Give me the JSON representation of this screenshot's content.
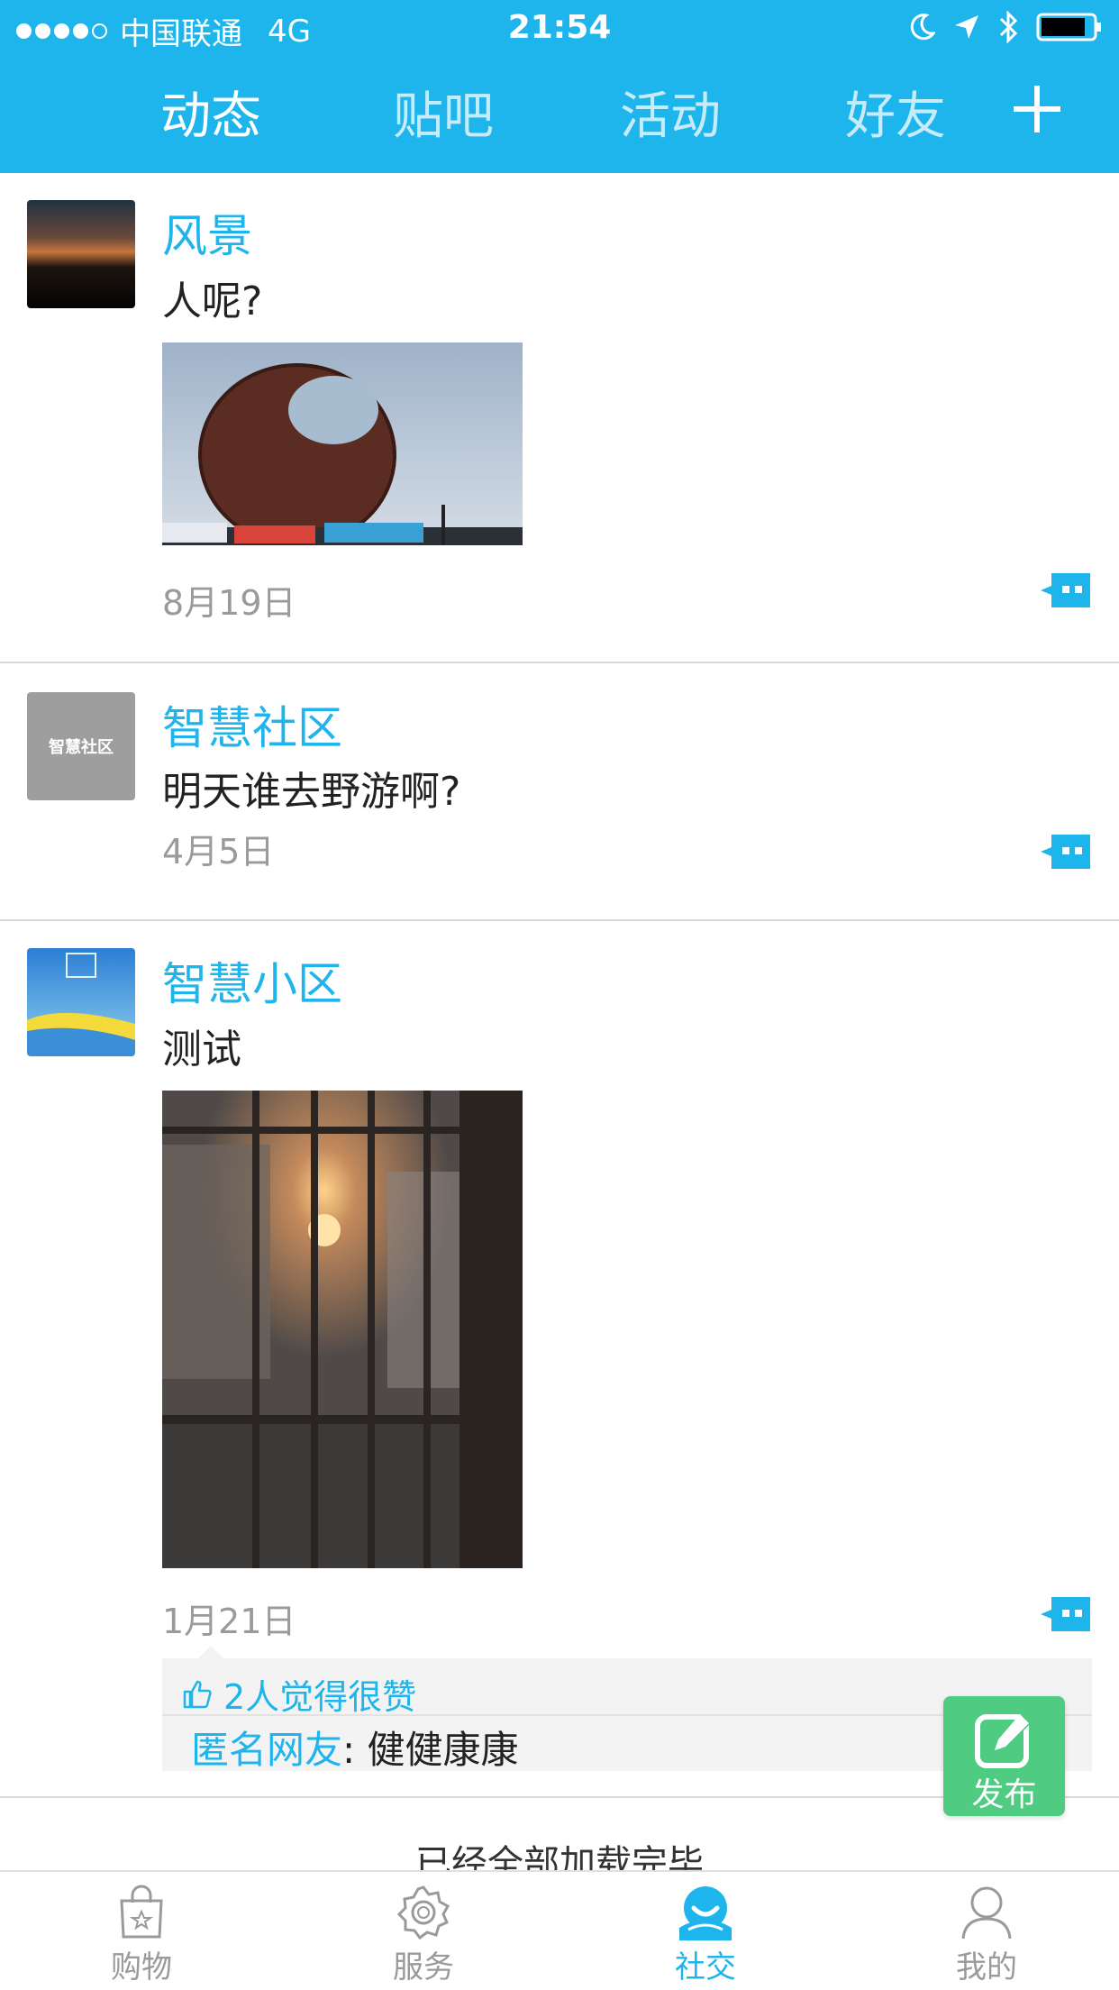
{
  "status_bar": {
    "carrier": "中国联通",
    "network": "4G",
    "time": "21:54"
  },
  "tabs": [
    {
      "label": "动态",
      "active": true
    },
    {
      "label": "贴吧",
      "active": false
    },
    {
      "label": "活动",
      "active": false
    },
    {
      "label": "好友",
      "active": false
    }
  ],
  "posts": [
    {
      "author": "风景",
      "text": "人呢?",
      "date": "8月19日",
      "image": "sculpture-photo"
    },
    {
      "author": "智慧社区",
      "text": "明天谁去野游啊?",
      "date": "4月5日",
      "avatar_text": "智慧社区"
    },
    {
      "author": "智慧小区",
      "text": "测试",
      "date": "1月21日",
      "image": "window-sunset-photo",
      "likes_text": "2人觉得很赞",
      "comment": {
        "user": "匿名网友",
        "separator": ": ",
        "text": "健健康康"
      }
    }
  ],
  "load_more": "已经全部加载完毕",
  "fab": {
    "label": "发布"
  },
  "bottom_nav": [
    {
      "label": "购物",
      "icon": "shopping-bag-icon"
    },
    {
      "label": "服务",
      "icon": "service-gear-icon"
    },
    {
      "label": "社交",
      "icon": "social-icon",
      "active": true
    },
    {
      "label": "我的",
      "icon": "person-icon"
    }
  ],
  "colors": {
    "primary": "#1eb4ec",
    "fab": "#4fcb82",
    "muted": "#9a9a9a"
  }
}
